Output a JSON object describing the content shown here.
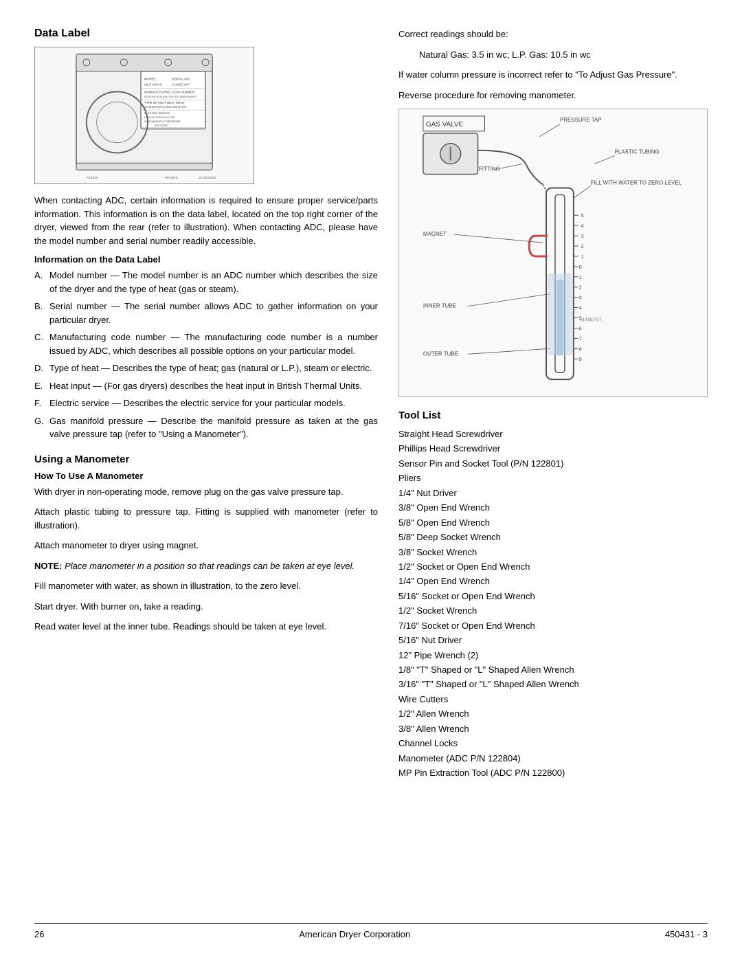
{
  "page": {
    "left_column": {
      "title": "Data Label",
      "intro_paragraph": "When contacting ADC, certain information is required to ensure proper service/parts information.  This information is on the data label, located on the top right corner of the dryer, viewed from the rear (refer to illustration).  When contacting ADC, please have the model number and serial number readily accessible.",
      "info_heading": "Information on the Data Label",
      "list_items": [
        {
          "letter": "A.",
          "text": "Model number — The model number is an ADC number which describes the size of the dryer and the type of heat (gas or steam)."
        },
        {
          "letter": "B.",
          "text": "Serial number — The serial number allows ADC to gather information on your particular dryer."
        },
        {
          "letter": "C.",
          "text": "Manufacturing code number — The manufacturing code number is a number issued by ADC, which describes all possible options on your particular model."
        },
        {
          "letter": "D.",
          "text": "Type of heat — Describes the type of heat; gas (natural or L.P.), steam or electric."
        },
        {
          "letter": "E.",
          "text": "Heat input — (For gas dryers) describes the heat input in British Thermal Units."
        },
        {
          "letter": "F.",
          "text": "Electric service — Describes the electric service for your particular models."
        },
        {
          "letter": "G.",
          "text": "Gas manifold pressure — Describe the manifold pressure as taken at the gas valve pressure tap (refer to \"Using a Manometer\")."
        }
      ],
      "manometer_section": {
        "title": "Using a Manometer",
        "how_to_heading": "How To Use A Manometer",
        "paragraphs": [
          "With dryer in non-operating mode, remove plug on the gas valve pressure tap.",
          "Attach plastic tubing to pressure tap. Fitting is supplied with manometer (refer to illustration).",
          "Attach manometer to dryer using magnet.",
          "",
          "Fill manometer with water, as shown in illustration, to the zero level.",
          "Start dryer.  With burner on, take a reading.",
          "Read water level at the inner tube. Readings should be taken at eye level."
        ],
        "note_text": "NOTE: Place manometer in a position so that readings can be taken at eye level."
      }
    },
    "right_column": {
      "correct_readings_label": "Correct readings should be:",
      "natural_gas_reading": "Natural Gas: 3.5 in wc; L.P. Gas: 10.5 in wc",
      "pressure_incorrect_text": "If water column pressure is incorrect refer to \"To Adjust Gas Pressure\".",
      "reverse_procedure_text": "Reverse procedure for removing manometer.",
      "tool_list": {
        "title": "Tool List",
        "items": [
          "Straight Head Screwdriver",
          "Phillips Head Screwdriver",
          "Sensor Pin and Socket Tool (P/N 122801)",
          "Pliers",
          "1/4\" Nut Driver",
          "3/8\" Open End Wrench",
          "5/8\" Open End Wrench",
          "5/8\" Deep Socket Wrench",
          "3/8\" Socket Wrench",
          "1/2\" Socket or Open End Wrench",
          "1/4\" Open End Wrench",
          "5/16\" Socket or Open End Wrench",
          "1/2\" Socket Wrench",
          "7/16\" Socket or Open End Wrench",
          "5/16\" Nut Driver",
          "12\" Pipe Wrench (2)",
          "1/8\" \"T\" Shaped or \"L\" Shaped Allen Wrench",
          "3/16\" \"T\" Shaped or \"L\" Shaped Allen Wrench",
          "Wire Cutters",
          "1/2\" Allen Wrench",
          "3/8\" Allen Wrench",
          "Channel Locks",
          "Manometer (ADC P/N 122804)",
          "MP Pin Extraction Tool (ADC P/N 122800)"
        ]
      }
    },
    "footer": {
      "page_number": "26",
      "company": "American Dryer Corporation",
      "document_number": "450431 - 3"
    }
  }
}
